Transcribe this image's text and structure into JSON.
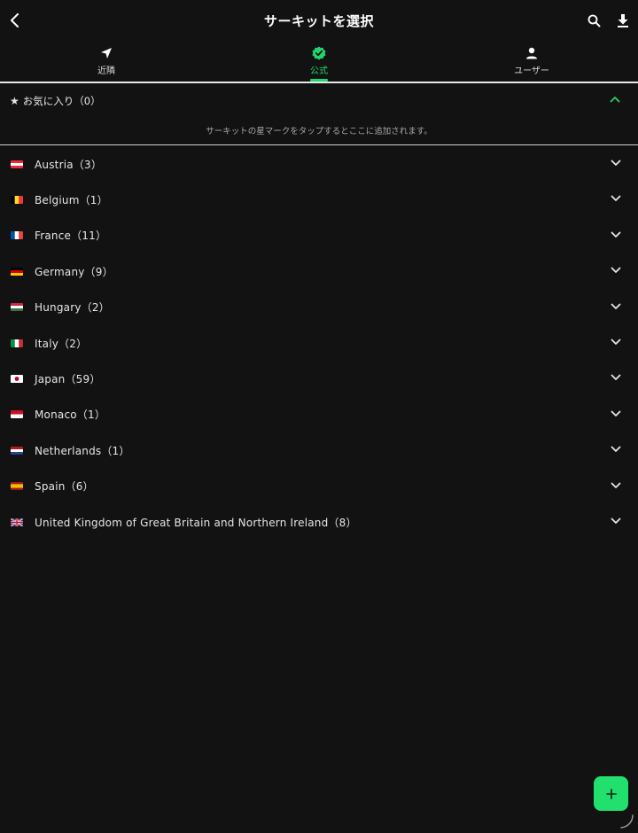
{
  "header": {
    "title": "サーキットを選択",
    "icons": {
      "back": "chevron-left-icon",
      "search": "search-icon",
      "download": "download-icon"
    }
  },
  "tabs": [
    {
      "label": "近隣",
      "icon": "navigation-arrow-icon",
      "active": false
    },
    {
      "label": "公式",
      "icon": "verified-badge-icon",
      "active": true
    },
    {
      "label": "ユーザー",
      "icon": "person-icon",
      "active": false
    }
  ],
  "favorites": {
    "star": "★",
    "label": "お気に入り（0）",
    "hint": "サーキットの星マークをタップするとここに追加されます。",
    "expanded": true
  },
  "countries": [
    {
      "label": "Austria（3）",
      "flag": "austria-flag-icon"
    },
    {
      "label": "Belgium（1）",
      "flag": "belgium-flag-icon"
    },
    {
      "label": "France（11）",
      "flag": "france-flag-icon"
    },
    {
      "label": "Germany（9）",
      "flag": "germany-flag-icon"
    },
    {
      "label": "Hungary（2）",
      "flag": "hungary-flag-icon"
    },
    {
      "label": "Italy（2）",
      "flag": "italy-flag-icon"
    },
    {
      "label": "Japan（59）",
      "flag": "japan-flag-icon"
    },
    {
      "label": "Monaco（1）",
      "flag": "monaco-flag-icon"
    },
    {
      "label": "Netherlands（1）",
      "flag": "netherlands-flag-icon"
    },
    {
      "label": "Spain（6）",
      "flag": "spain-flag-icon"
    },
    {
      "label": "United Kingdom of Great Britain and Northern Ireland（8）",
      "flag": "uk-flag-icon"
    }
  ],
  "fab": {
    "icon": "plus-icon"
  },
  "colors": {
    "background": "#121212",
    "accent": "#22d46b",
    "fab": "#22e06e",
    "text": "#e6e6e6"
  }
}
